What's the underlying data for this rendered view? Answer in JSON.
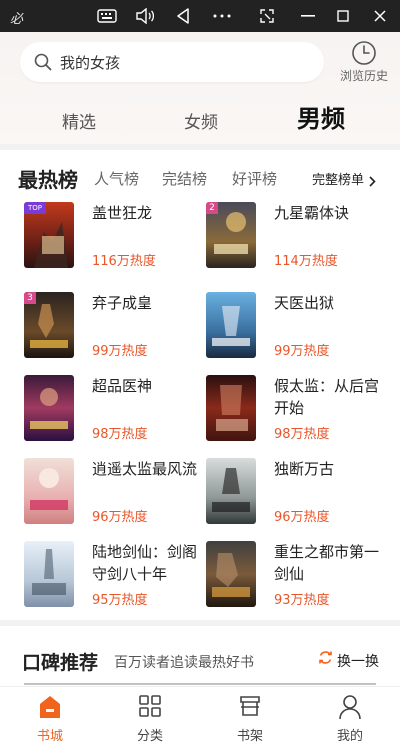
{
  "titlebar": {
    "app_title": "必",
    "icons": [
      "keyboard-icon",
      "volume-icon",
      "back-icon",
      "more-icon",
      "screenshot-icon",
      "minimize-icon",
      "restore-icon",
      "close-icon"
    ]
  },
  "search": {
    "query": "我的女孩"
  },
  "history": {
    "label": "浏览历史"
  },
  "tabs": [
    {
      "label": "精选",
      "active": false
    },
    {
      "label": "女频",
      "active": false
    },
    {
      "label": "男频",
      "active": true
    }
  ],
  "ranking": {
    "title": "最热榜",
    "subtabs": [
      "人气榜",
      "完结榜",
      "好评榜"
    ],
    "full_list_label": "完整榜单",
    "badges": [
      "TOP",
      "2",
      "3"
    ],
    "books": [
      {
        "title": "盖世狂龙",
        "heat": "116万热度"
      },
      {
        "title": "九星霸体诀",
        "heat": "114万热度"
      },
      {
        "title": "弃子成皇",
        "heat": "99万热度"
      },
      {
        "title": "天医出狱",
        "heat": "99万热度"
      },
      {
        "title": "超品医神",
        "heat": "98万热度"
      },
      {
        "title": "假太监：从后宫开始",
        "heat": "98万热度"
      },
      {
        "title": "逍遥太监最风流",
        "heat": "96万热度"
      },
      {
        "title": "独断万古",
        "heat": "96万热度"
      },
      {
        "title": "陆地剑仙：剑阁守剑八十年",
        "heat": "95万热度"
      },
      {
        "title": "重生之都市第一剑仙",
        "heat": "93万热度"
      }
    ]
  },
  "reputation": {
    "title": "口碑推荐",
    "subtitle": "百万读者追读最热好书",
    "refresh_label": "换一换"
  },
  "nav": [
    {
      "label": "书城",
      "active": true
    },
    {
      "label": "分类",
      "active": false
    },
    {
      "label": "书架",
      "active": false
    },
    {
      "label": "我的",
      "active": false
    }
  ],
  "colors": {
    "accent": "#f0641e",
    "heat": "#e8562a",
    "titlebar": "#222222"
  }
}
